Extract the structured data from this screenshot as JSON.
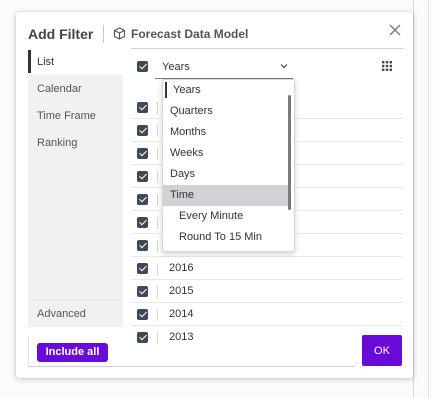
{
  "dialog": {
    "title": "Add Filter",
    "model_name": "Forecast Data Model"
  },
  "tabs": [
    "List",
    "Calendar",
    "Time Frame",
    "Ranking"
  ],
  "advanced_tab": "Advanced",
  "list": {
    "granularity_value": "Years",
    "rows": [
      "",
      "",
      "",
      "",
      "",
      "",
      "",
      "2016",
      "2015",
      "2014",
      "2013"
    ]
  },
  "dropdown": {
    "options": [
      "Years",
      "Quarters",
      "Months",
      "Weeks",
      "Days",
      "Time",
      "Every Minute",
      "Round To 15 Min"
    ],
    "highlighted": "Time"
  },
  "footer": {
    "include_all_label": "Include all",
    "ok_label": "OK"
  },
  "colors": {
    "accent": "#6a0ad9",
    "checkbox": "#3f4a58"
  },
  "icons": {
    "model": "cube-icon",
    "close": "close-icon",
    "grid": "grid-icon",
    "chevron": "chevron-down-icon"
  }
}
